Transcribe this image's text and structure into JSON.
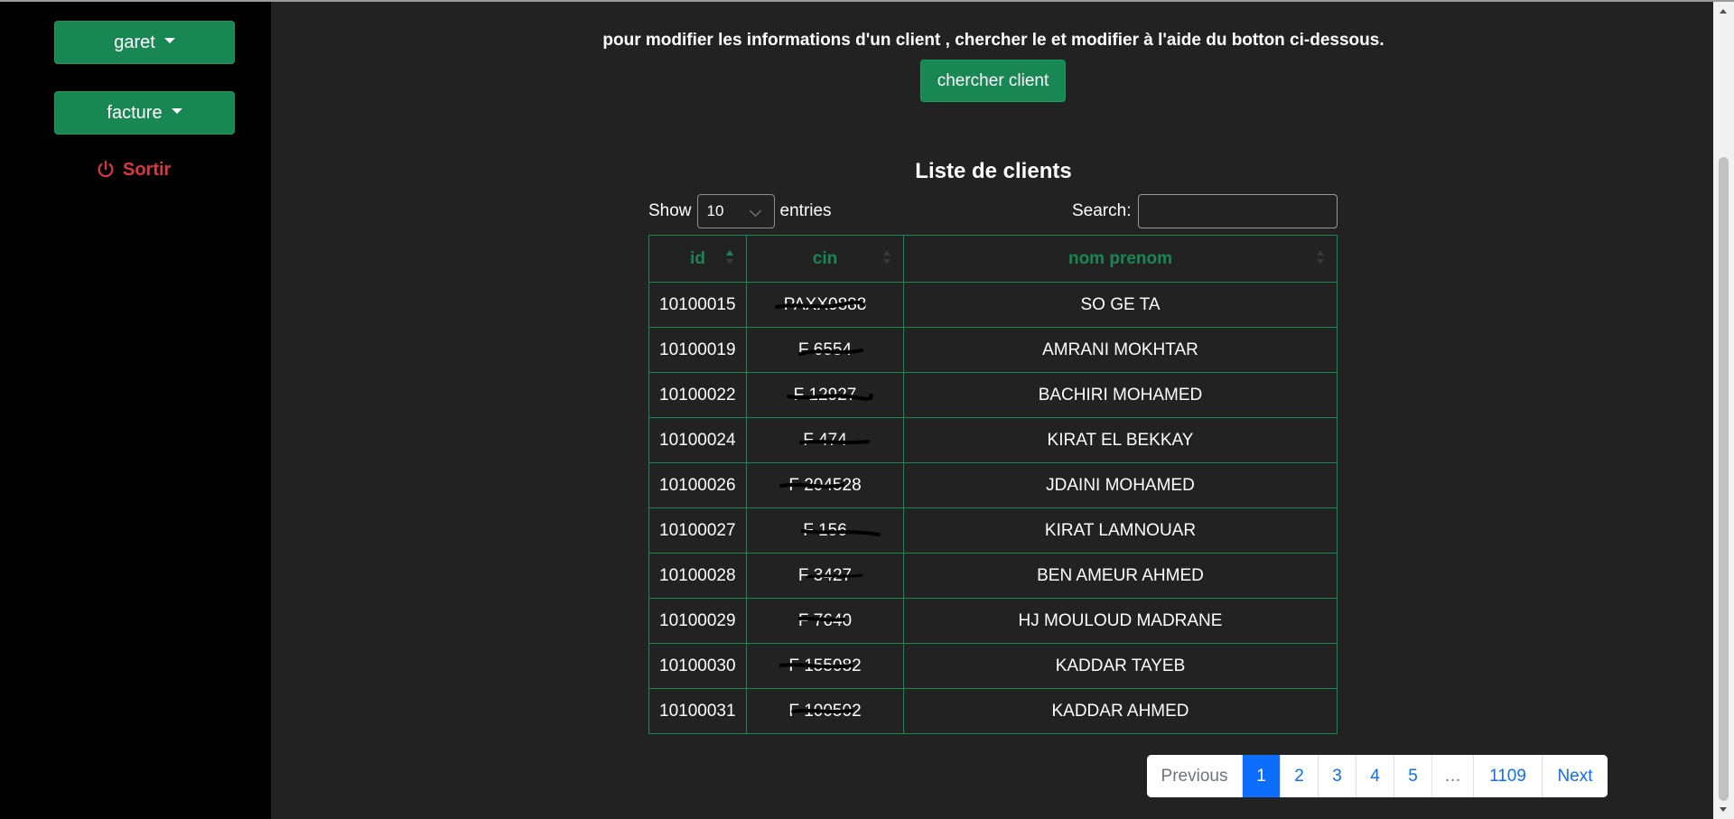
{
  "sidebar": {
    "garet_label": "garet",
    "facture_label": "facture",
    "sortir_label": "Sortir",
    "accent_color": "#198754",
    "danger_color": "#dc3545"
  },
  "main": {
    "intro_text": "pour modifier les informations d'un client , chercher le et modifier à l'aide du botton ci-dessous.",
    "search_client_button": "chercher client",
    "list_title": "Liste de clients",
    "length": {
      "show_label": "Show",
      "selected_value": "10",
      "entries_label": "entries"
    },
    "search_label": "Search:",
    "search_value": ""
  },
  "table": {
    "headers": [
      "id",
      "cin",
      "nom prenom"
    ],
    "rows": [
      {
        "id": "10100015",
        "cin": "PAXX0888",
        "name": "SO GE TA"
      },
      {
        "id": "10100019",
        "cin": "F 6554",
        "name": "AMRANI MOKHTAR"
      },
      {
        "id": "10100022",
        "cin": "F 12927",
        "name": "BACHIRI MOHAMED"
      },
      {
        "id": "10100024",
        "cin": "F 474",
        "name": "KIRAT EL BEKKAY"
      },
      {
        "id": "10100026",
        "cin": "F 204528",
        "name": "JDAINI MOHAMED"
      },
      {
        "id": "10100027",
        "cin": "F 156",
        "name": "KIRAT LAMNOUAR"
      },
      {
        "id": "10100028",
        "cin": "F 3427",
        "name": "BEN AMEUR AHMED"
      },
      {
        "id": "10100029",
        "cin": "F 7640",
        "name": "HJ MOULOUD MADRANE"
      },
      {
        "id": "10100030",
        "cin": "F 155082",
        "name": "KADDAR TAYEB"
      },
      {
        "id": "10100031",
        "cin": "F 100502",
        "name": "KADDAR AHMED"
      }
    ]
  },
  "pagination": {
    "previous": "Previous",
    "pages": [
      "1",
      "2",
      "3",
      "4",
      "5",
      "…",
      "1109"
    ],
    "next": "Next",
    "active_page": "1",
    "active_color": "#0d6efd"
  }
}
